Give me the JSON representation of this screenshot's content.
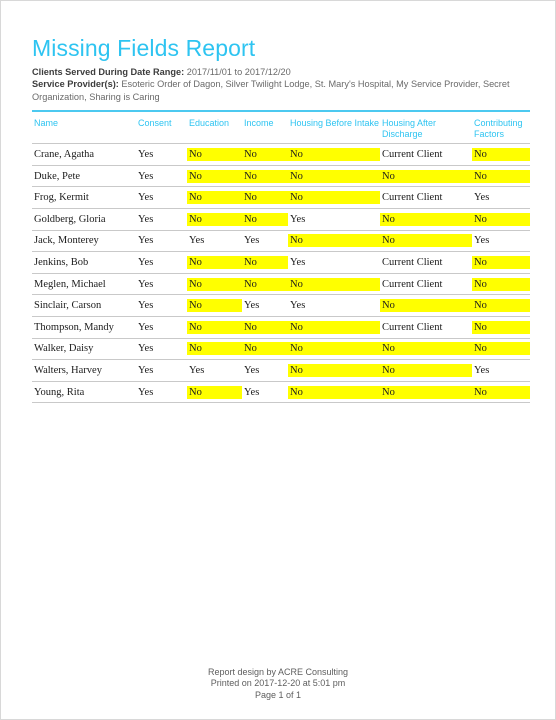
{
  "report": {
    "title": "Missing Fields Report",
    "meta": [
      {
        "label": "Clients Served During Date Range:",
        "value": "2017/11/01 to 2017/12/20"
      },
      {
        "label": "Service Provider(s):",
        "value": "Esoteric Order of Dagon, Silver Twilight Lodge, St. Mary's Hospital, My Service Provider, Secret Organization, Sharing is Caring"
      }
    ],
    "accent_color": "#2ec4f1",
    "highlight_color": "#ffff00",
    "rule_color": "#4cc9f0"
  },
  "table": {
    "columns": [
      "Name",
      "Consent",
      "Education",
      "Income",
      "Housing Before Intake",
      "Housing After Discharge",
      "Contributing Factors"
    ],
    "rows": [
      {
        "name": "Crane, Agatha",
        "consent": "Yes",
        "education": "No",
        "income": "No",
        "housing_before_intake": "No",
        "housing_after_discharge": "Current Client",
        "contributing_factors": "No",
        "highlight": {
          "consent": false,
          "education": true,
          "income": true,
          "housing_before_intake": true,
          "housing_after_discharge": false,
          "contributing_factors": true
        }
      },
      {
        "name": "Duke, Pete",
        "consent": "Yes",
        "education": "No",
        "income": "No",
        "housing_before_intake": "No",
        "housing_after_discharge": "No",
        "contributing_factors": "No",
        "highlight": {
          "consent": false,
          "education": true,
          "income": true,
          "housing_before_intake": true,
          "housing_after_discharge": true,
          "contributing_factors": true
        }
      },
      {
        "name": "Frog, Kermit",
        "consent": "Yes",
        "education": "No",
        "income": "No",
        "housing_before_intake": "No",
        "housing_after_discharge": "Current Client",
        "contributing_factors": "Yes",
        "highlight": {
          "consent": false,
          "education": true,
          "income": true,
          "housing_before_intake": true,
          "housing_after_discharge": false,
          "contributing_factors": false
        }
      },
      {
        "name": "Goldberg, Gloria",
        "consent": "Yes",
        "education": "No",
        "income": "No",
        "housing_before_intake": "Yes",
        "housing_after_discharge": "No",
        "contributing_factors": "No",
        "highlight": {
          "consent": false,
          "education": true,
          "income": true,
          "housing_before_intake": false,
          "housing_after_discharge": true,
          "contributing_factors": true
        }
      },
      {
        "name": "Jack, Monterey",
        "consent": "Yes",
        "education": "Yes",
        "income": "Yes",
        "housing_before_intake": "No",
        "housing_after_discharge": "No",
        "contributing_factors": "Yes",
        "highlight": {
          "consent": false,
          "education": false,
          "income": false,
          "housing_before_intake": true,
          "housing_after_discharge": true,
          "contributing_factors": false
        }
      },
      {
        "name": "Jenkins, Bob",
        "consent": "Yes",
        "education": "No",
        "income": "No",
        "housing_before_intake": "Yes",
        "housing_after_discharge": "Current Client",
        "contributing_factors": "No",
        "highlight": {
          "consent": false,
          "education": true,
          "income": true,
          "housing_before_intake": false,
          "housing_after_discharge": false,
          "contributing_factors": true
        }
      },
      {
        "name": "Meglen, Michael",
        "consent": "Yes",
        "education": "No",
        "income": "No",
        "housing_before_intake": "No",
        "housing_after_discharge": "Current Client",
        "contributing_factors": "No",
        "highlight": {
          "consent": false,
          "education": true,
          "income": true,
          "housing_before_intake": true,
          "housing_after_discharge": false,
          "contributing_factors": true
        }
      },
      {
        "name": "Sinclair, Carson",
        "consent": "Yes",
        "education": "No",
        "income": "Yes",
        "housing_before_intake": "Yes",
        "housing_after_discharge": "No",
        "contributing_factors": "No",
        "highlight": {
          "consent": false,
          "education": true,
          "income": false,
          "housing_before_intake": false,
          "housing_after_discharge": true,
          "contributing_factors": true
        }
      },
      {
        "name": "Thompson, Mandy",
        "consent": "Yes",
        "education": "No",
        "income": "No",
        "housing_before_intake": "No",
        "housing_after_discharge": "Current Client",
        "contributing_factors": "No",
        "highlight": {
          "consent": false,
          "education": true,
          "income": true,
          "housing_before_intake": true,
          "housing_after_discharge": false,
          "contributing_factors": true
        }
      },
      {
        "name": "Walker, Daisy",
        "consent": "Yes",
        "education": "No",
        "income": "No",
        "housing_before_intake": "No",
        "housing_after_discharge": "No",
        "contributing_factors": "No",
        "highlight": {
          "consent": false,
          "education": true,
          "income": true,
          "housing_before_intake": true,
          "housing_after_discharge": true,
          "contributing_factors": true
        }
      },
      {
        "name": "Walters, Harvey",
        "consent": "Yes",
        "education": "Yes",
        "income": "Yes",
        "housing_before_intake": "No",
        "housing_after_discharge": "No",
        "contributing_factors": "Yes",
        "highlight": {
          "consent": false,
          "education": false,
          "income": false,
          "housing_before_intake": true,
          "housing_after_discharge": true,
          "contributing_factors": false
        }
      },
      {
        "name": "Young, Rita",
        "consent": "Yes",
        "education": "No",
        "income": "Yes",
        "housing_before_intake": "No",
        "housing_after_discharge": "No",
        "contributing_factors": "No",
        "highlight": {
          "consent": false,
          "education": true,
          "income": false,
          "housing_before_intake": true,
          "housing_after_discharge": true,
          "contributing_factors": true
        }
      }
    ]
  },
  "footer": {
    "credit": "Report design by ACRE Consulting",
    "printed": "Printed on 2017-12-20 at  5:01 pm",
    "page": "Page 1 of 1"
  }
}
